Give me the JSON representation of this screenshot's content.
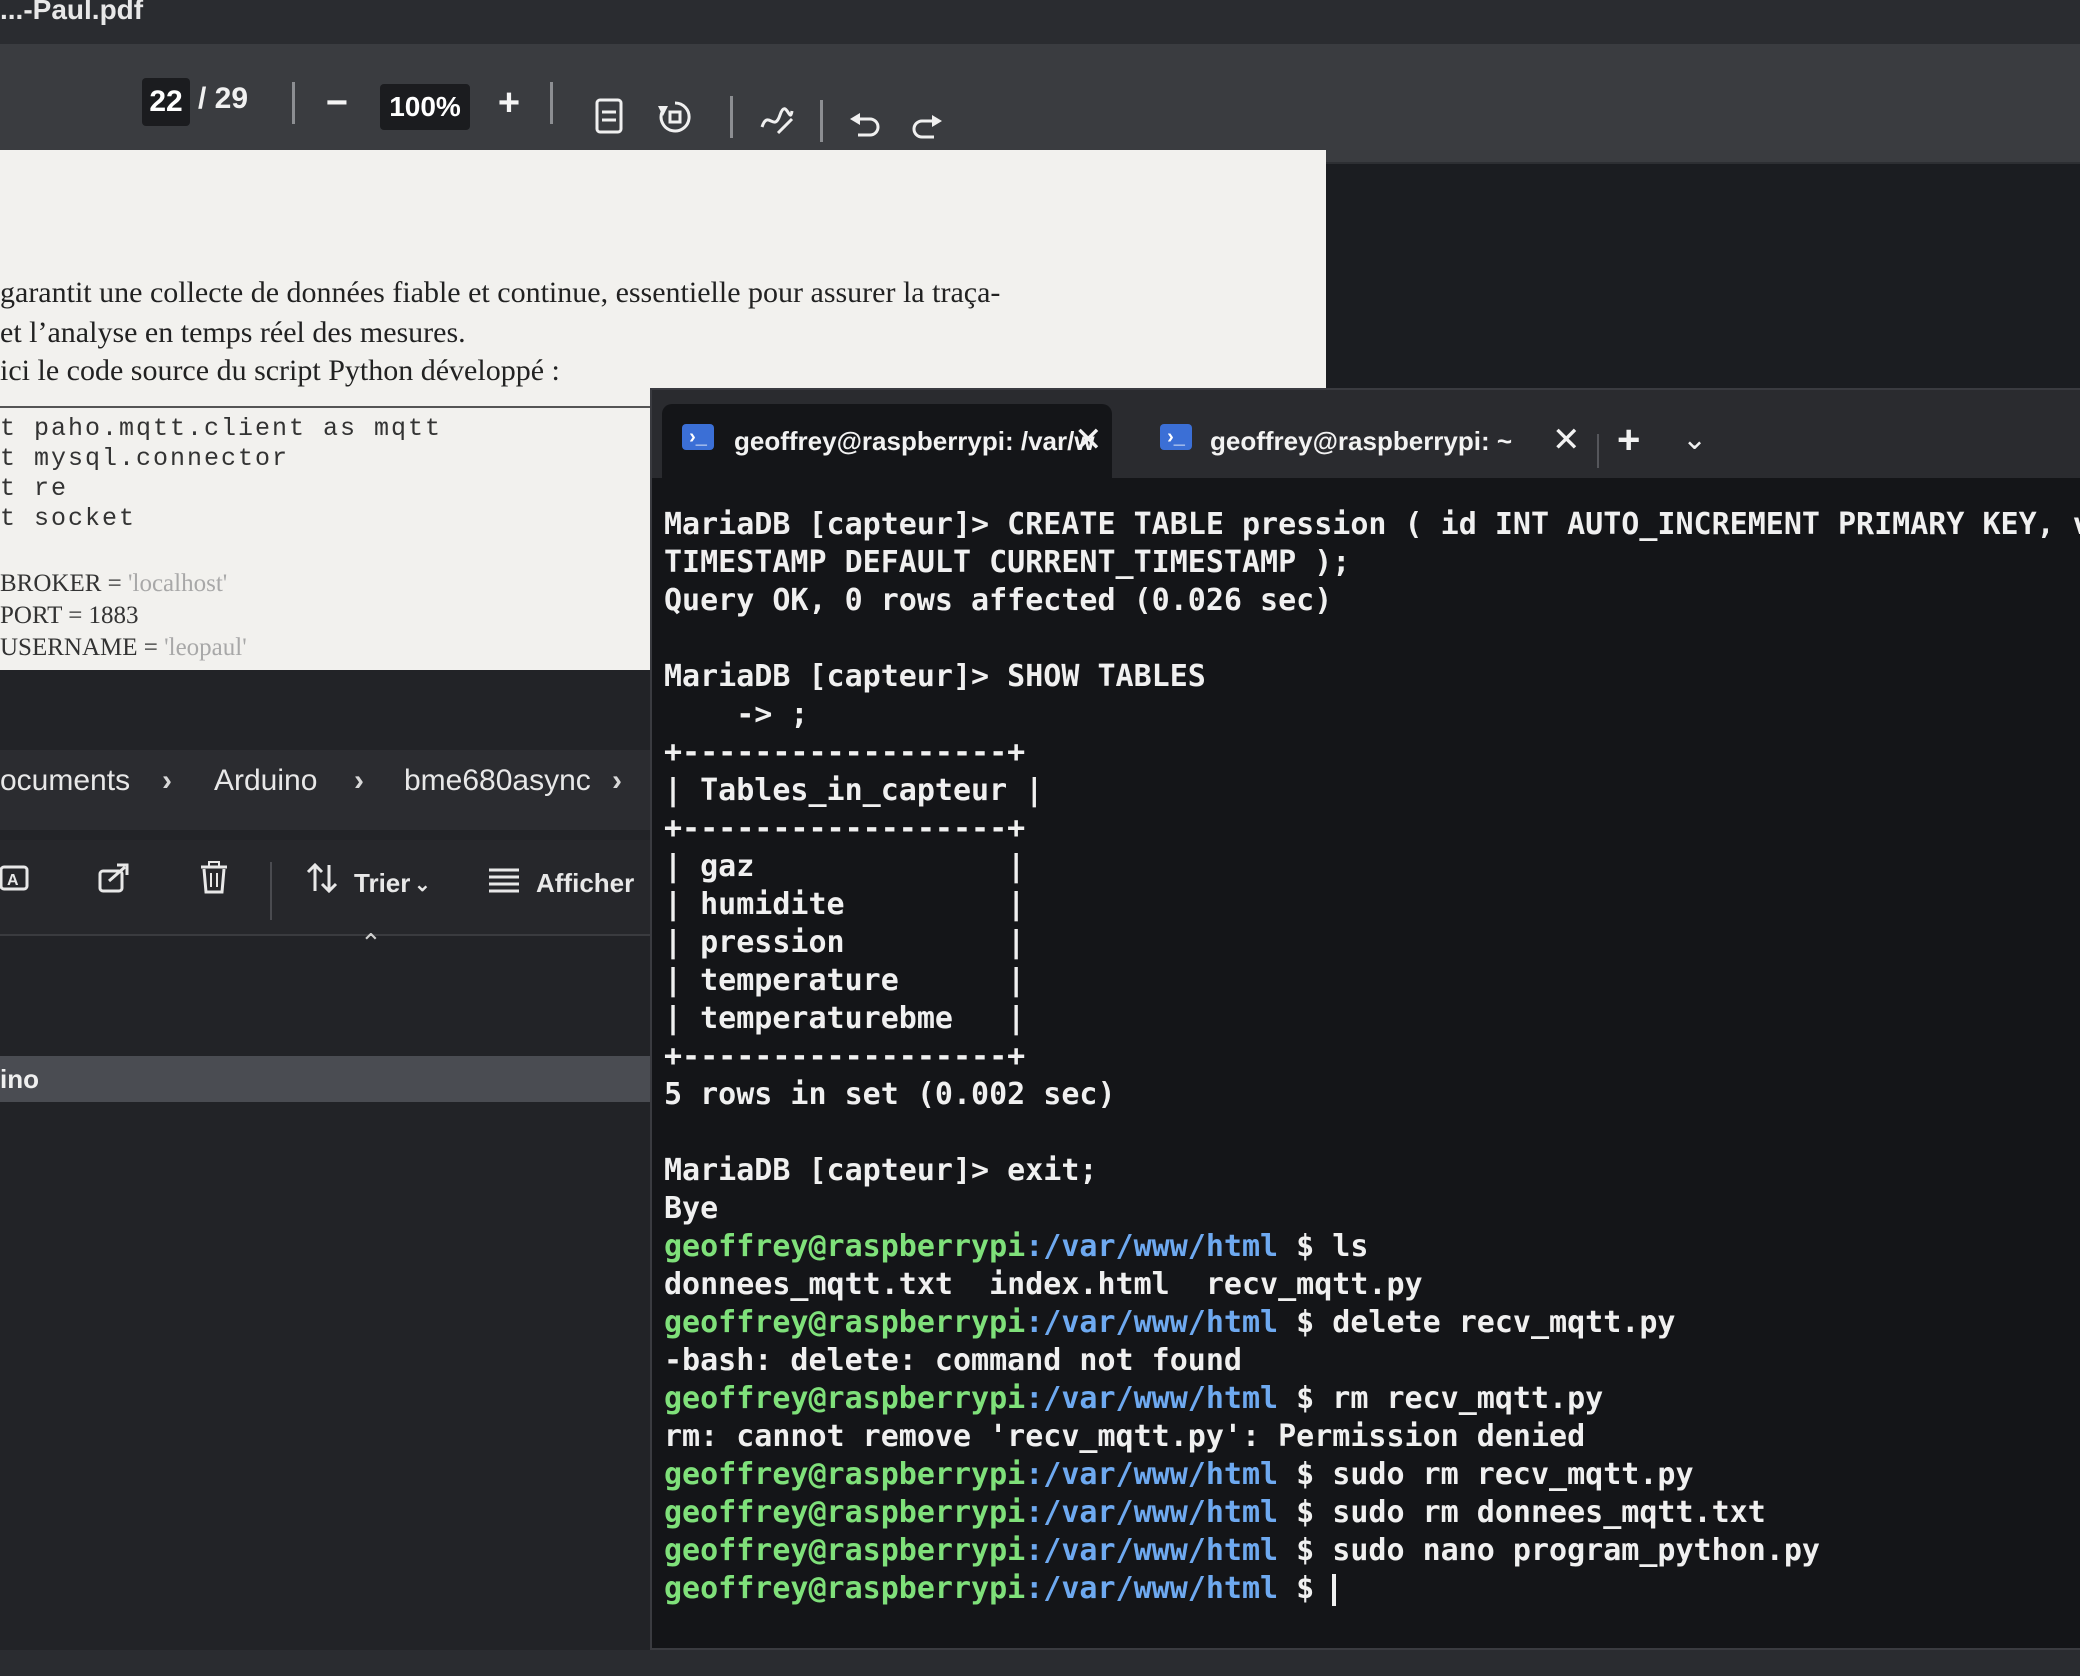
{
  "pdf": {
    "filename": "...-Paul.pdf",
    "page_current": "22",
    "page_total": "/ 29",
    "zoom": "100%",
    "zoom_out": "−",
    "zoom_in": "+",
    "icons": [
      "page-view-icon",
      "rotate-icon",
      "draw-icon",
      "undo-icon",
      "redo-icon"
    ],
    "text_lines": [
      "garantit une collecte de données fiable et continue, essentielle pour assurer la traça-",
      "et l’analyse en temps réel des mesures.",
      "ici le code source du script Python développé :"
    ],
    "code_lines": [
      "t paho.mqtt.client as mqtt",
      "t mysql.connector",
      "t re",
      "t socket"
    ],
    "config_lines": [
      {
        "key": "BROKER = ",
        "val": "'localhost'"
      },
      {
        "key": "PORT = 1883",
        "val": ""
      },
      {
        "key": "USERNAME = ",
        "val": "'leopaul'"
      }
    ]
  },
  "explorer": {
    "breadcrumb": [
      "ocuments",
      "Arduino",
      "bme680async"
    ],
    "breadcrumb_sep": "›",
    "sort_label": "Trier",
    "view_label": "Afficher",
    "selected_file": "ino"
  },
  "terminal": {
    "tabs": [
      {
        "title": "geoffrey@raspberrypi: /var/w",
        "active": true
      },
      {
        "title": "geoffrey@raspberrypi: ~",
        "active": false
      }
    ],
    "close_glyph": "✕",
    "new_tab": "+",
    "menu": "⌄",
    "prompt_user": "geoffrey@raspberrypi",
    "prompt_path": ":/var/www/html",
    "prompt_suffix": " $ ",
    "lines": [
      {
        "type": "out",
        "text": "MariaDB [capteur]> CREATE TABLE pression ( id INT AUTO_INCREMENT PRIMARY KEY, vale"
      },
      {
        "type": "out",
        "text": "TIMESTAMP DEFAULT CURRENT_TIMESTAMP );"
      },
      {
        "type": "out",
        "text": "Query OK, 0 rows affected (0.026 sec)"
      },
      {
        "type": "gap"
      },
      {
        "type": "out",
        "text": "MariaDB [capteur]> SHOW TABLES"
      },
      {
        "type": "out",
        "text": "    -> ;"
      },
      {
        "type": "out",
        "text": "+------------------+"
      },
      {
        "type": "out",
        "text": "| Tables_in_capteur |"
      },
      {
        "type": "out",
        "text": "+------------------+"
      },
      {
        "type": "out",
        "text": "| gaz              |"
      },
      {
        "type": "out",
        "text": "| humidite         |"
      },
      {
        "type": "out",
        "text": "| pression         |"
      },
      {
        "type": "out",
        "text": "| temperature      |"
      },
      {
        "type": "out",
        "text": "| temperaturebme   |"
      },
      {
        "type": "out",
        "text": "+------------------+"
      },
      {
        "type": "out",
        "text": "5 rows in set (0.002 sec)"
      },
      {
        "type": "gap"
      },
      {
        "type": "out",
        "text": "MariaDB [capteur]> exit;"
      },
      {
        "type": "out",
        "text": "Bye"
      },
      {
        "type": "prompt",
        "text": "ls"
      },
      {
        "type": "out",
        "text": "donnees_mqtt.txt  index.html  recv_mqtt.py"
      },
      {
        "type": "prompt",
        "text": "delete recv_mqtt.py"
      },
      {
        "type": "out",
        "text": "-bash: delete: command not found"
      },
      {
        "type": "prompt",
        "text": "rm recv_mqtt.py"
      },
      {
        "type": "out",
        "text": "rm: cannot remove 'recv_mqtt.py': Permission denied"
      },
      {
        "type": "prompt",
        "text": "sudo rm recv_mqtt.py"
      },
      {
        "type": "prompt",
        "text": "sudo rm donnees_mqtt.txt"
      },
      {
        "type": "prompt",
        "text": "sudo nano program_python.py"
      },
      {
        "type": "prompt",
        "text": "",
        "cursor": true
      }
    ]
  }
}
